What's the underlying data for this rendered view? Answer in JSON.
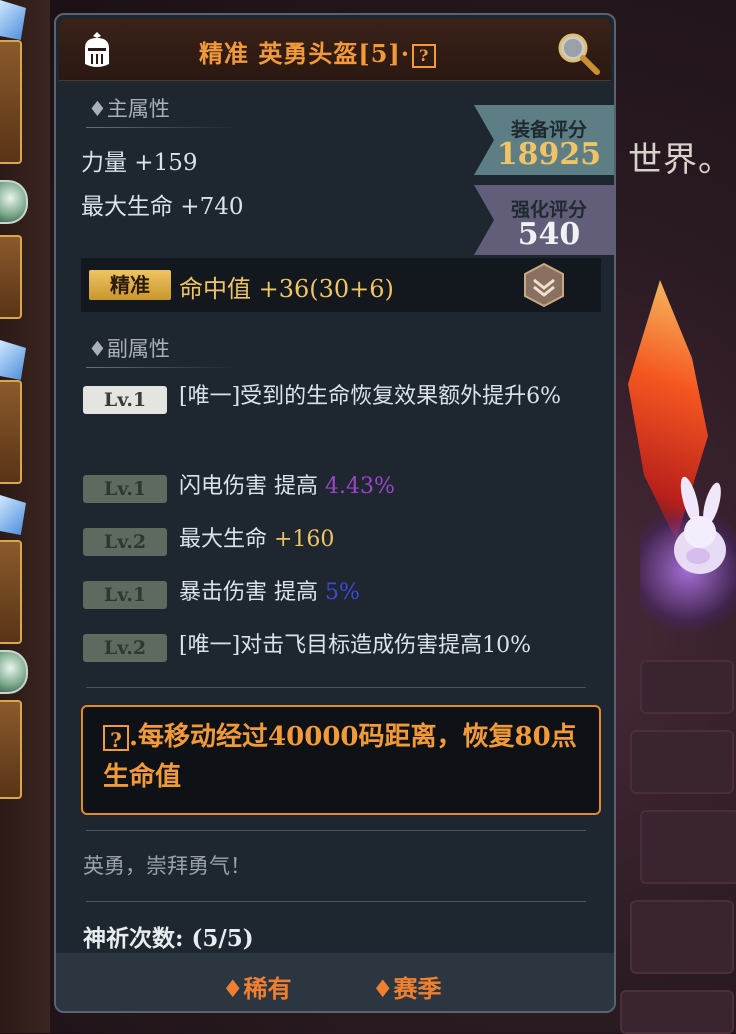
{
  "colors": {
    "accent_orange": "#f29a3a",
    "gold": "#f0c464",
    "purple": "#9b45c8",
    "blue": "#3f48d8",
    "panel_bg": "#1e2630"
  },
  "background": {
    "world_text": "世界。"
  },
  "header": {
    "title": "精准 英勇头盔[5]·",
    "title_suffix_icon": "?",
    "left_icon": "knight-helmet-icon",
    "right_icon": "magnifier-icon"
  },
  "main_attr": {
    "title": "♦主属性",
    "stats": [
      "力量 +159",
      "最大生命 +740"
    ]
  },
  "scores": {
    "equip_label": "装备评分",
    "equip_value": "18925",
    "enhance_label": "强化评分",
    "enhance_value": "540"
  },
  "enhance": {
    "tag": "精准",
    "text": "命中值 +36(30+6)",
    "icon": "rank-shield-icon"
  },
  "sub_attr": {
    "title": "♦副属性",
    "items": [
      {
        "level": "Lv.1",
        "text": "[唯一]受到的生命恢复效果额外提升6%",
        "value": ""
      },
      {
        "level": "Lv.1",
        "text": "闪电伤害 提高 ",
        "value": "4.43%"
      },
      {
        "level": "Lv.2",
        "text": "最大生命 ",
        "value": "+160"
      },
      {
        "level": "Lv.1",
        "text": "暴击伤害 提高 ",
        "value": "5%"
      },
      {
        "level": "Lv.2",
        "text": "[唯一]对击飞目标造成伤害提高10%",
        "value": ""
      }
    ]
  },
  "special": {
    "icon": "?",
    "text": ".每移动经过40000码距离，恢复80点生命值"
  },
  "flavor": "英勇，崇拜勇气！",
  "prayer": "神祈次数: (5/5)",
  "footer": {
    "tag1": "♦稀有",
    "tag2": "♦赛季"
  }
}
